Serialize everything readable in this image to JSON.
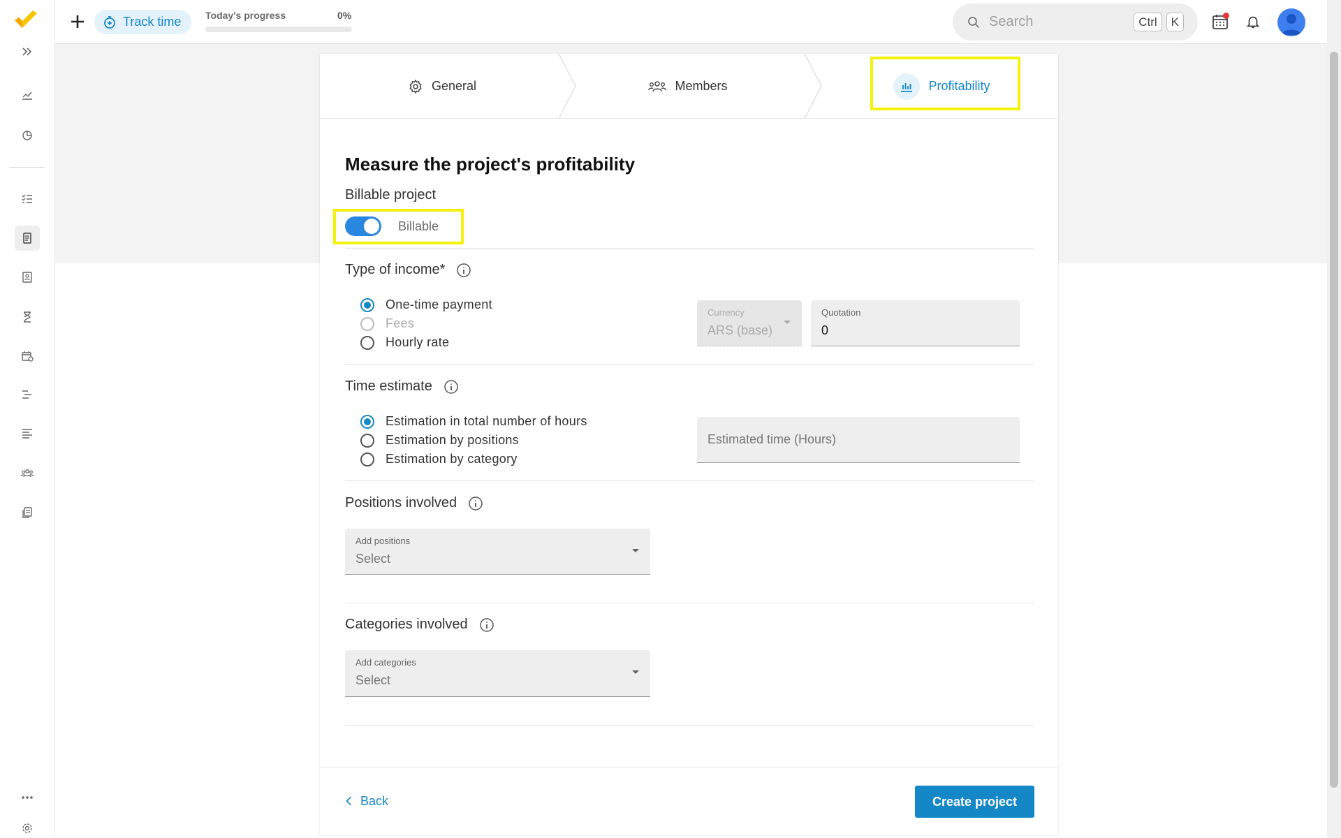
{
  "topbar": {
    "track_time_label": "Track time",
    "progress_label": "Today's progress",
    "progress_value": "0%",
    "progress_fraction": 0,
    "search_placeholder": "Search",
    "shortcut_key_1": "Ctrl",
    "shortcut_key_2": "K"
  },
  "sidebar": {
    "icons": [
      "logo-icon",
      "expand-icon",
      "analytics-icon",
      "reports-icon",
      "tasks-icon",
      "projects-icon",
      "clients-icon",
      "timesheet-icon",
      "calendar-icon",
      "gantt-icon",
      "list-icon",
      "team-icon",
      "documents-icon",
      "more-icon",
      "settings-icon"
    ]
  },
  "steps": {
    "general": "General",
    "members": "Members",
    "profitability": "Profitability"
  },
  "form": {
    "title": "Measure the project's profitability",
    "billable_label": "Billable project",
    "billable_toggle_label": "Billable",
    "billable_on": true,
    "income_label": "Type of income*",
    "income_options": [
      {
        "label": "One-time payment",
        "checked": true,
        "disabled": false
      },
      {
        "label": "Fees",
        "checked": false,
        "disabled": true
      },
      {
        "label": "Hourly rate",
        "checked": false,
        "disabled": false
      }
    ],
    "currency_label": "Currency",
    "currency_value": "ARS (base)",
    "quotation_label": "Quotation",
    "quotation_value": "0",
    "time_label": "Time estimate",
    "time_options": [
      {
        "label": "Estimation in total number of hours",
        "checked": true
      },
      {
        "label": "Estimation by positions",
        "checked": false
      },
      {
        "label": "Estimation by category",
        "checked": false
      }
    ],
    "estimated_time_placeholder": "Estimated time (Hours)",
    "positions_label": "Positions involved",
    "positions_field_label": "Add positions",
    "positions_placeholder": "Select",
    "categories_label": "Categories involved",
    "categories_field_label": "Add categories",
    "categories_placeholder": "Select"
  },
  "footer": {
    "back_label": "Back",
    "create_label": "Create project"
  },
  "colors": {
    "accent": "#1487c7",
    "highlight": "#f4f10a",
    "toggle": "#2a87e0",
    "logo": "#f7c600"
  }
}
